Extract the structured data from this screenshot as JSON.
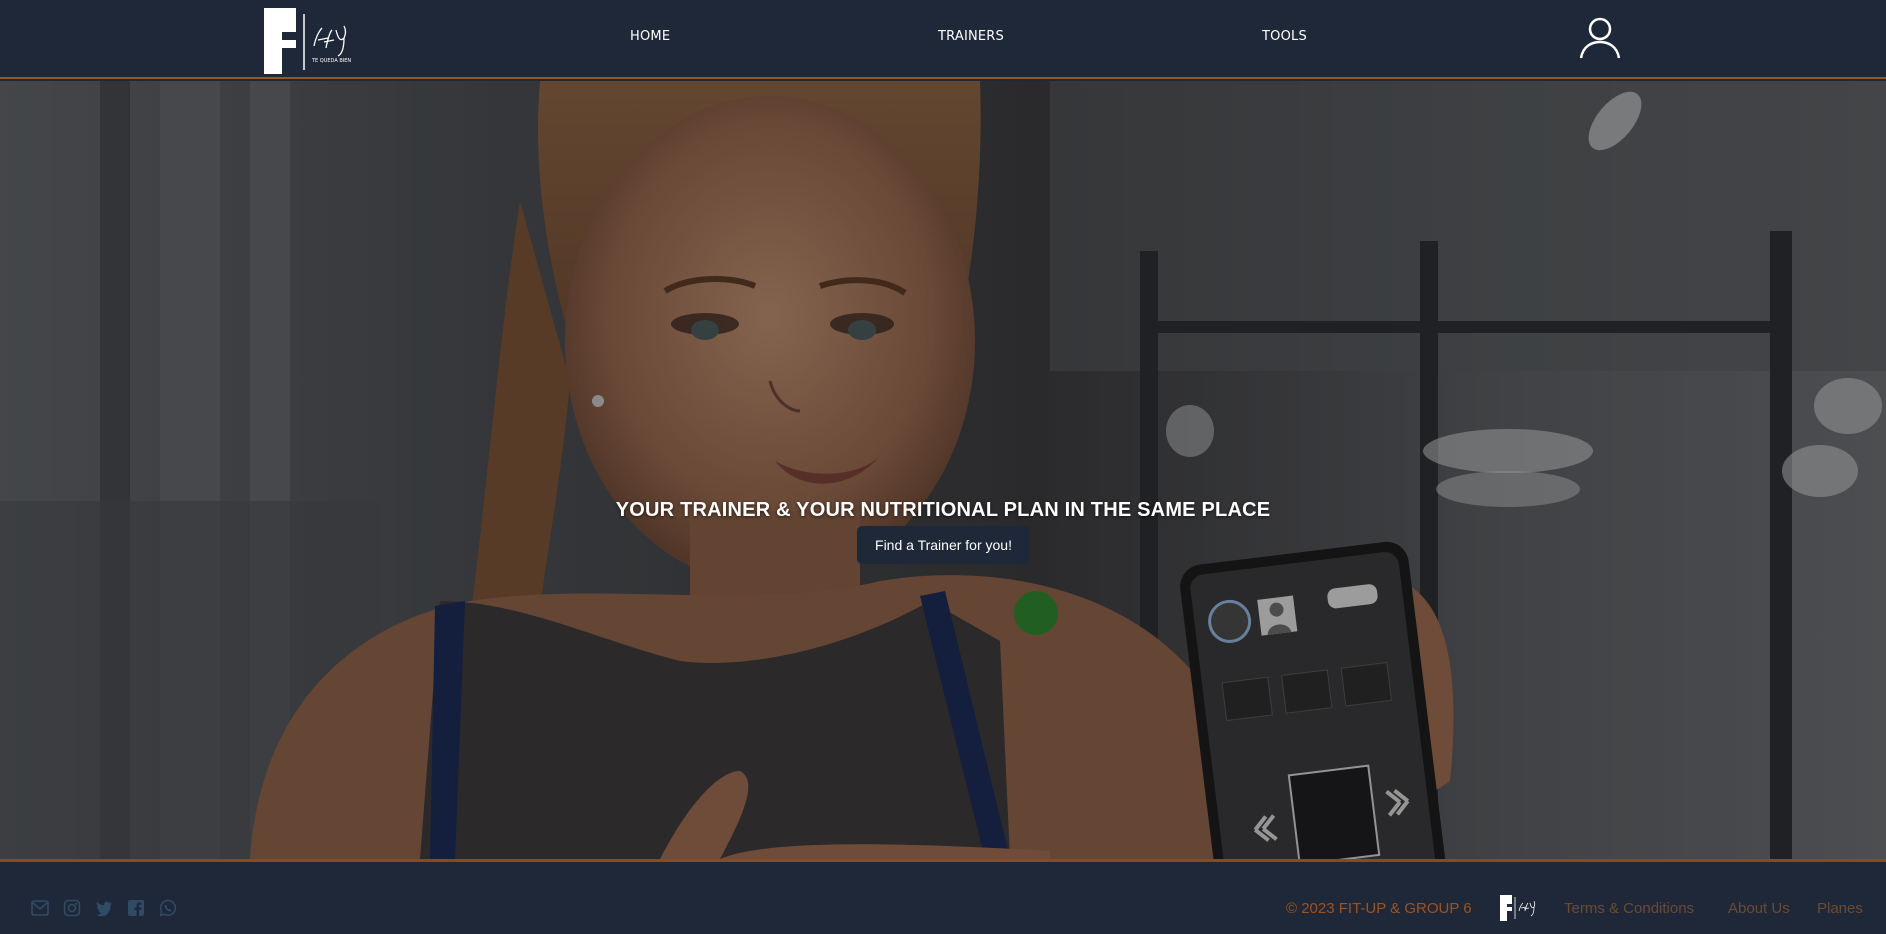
{
  "header": {
    "logo": {
      "icon": "fitup-logo",
      "tagline": "TE QUEDA BIEN"
    },
    "nav": [
      {
        "label": "HOME"
      },
      {
        "label": "TRAINERS"
      },
      {
        "label": "TOOLS"
      }
    ],
    "user_icon": "user-icon"
  },
  "hero": {
    "title": "YOUR TRAINER & YOUR NUTRITIONAL PLAN IN THE SAME PLACE",
    "cta_label": "Find a Trainer for you!"
  },
  "footer": {
    "social_icons": [
      "email-icon",
      "instagram-icon",
      "twitter-icon",
      "facebook-icon",
      "whatsapp-icon"
    ],
    "copyright": "© 2023 FIT-UP & GROUP 6",
    "links": [
      {
        "label": "Terms & Conditions"
      },
      {
        "label": "About Us"
      },
      {
        "label": "Planes"
      }
    ]
  },
  "colors": {
    "header_bg": "#1f2838",
    "accent_border": "#8a5a2b",
    "footer_text": "#a0521c",
    "footer_link": "#6b4a33",
    "social_icon": "#2f4b66"
  }
}
